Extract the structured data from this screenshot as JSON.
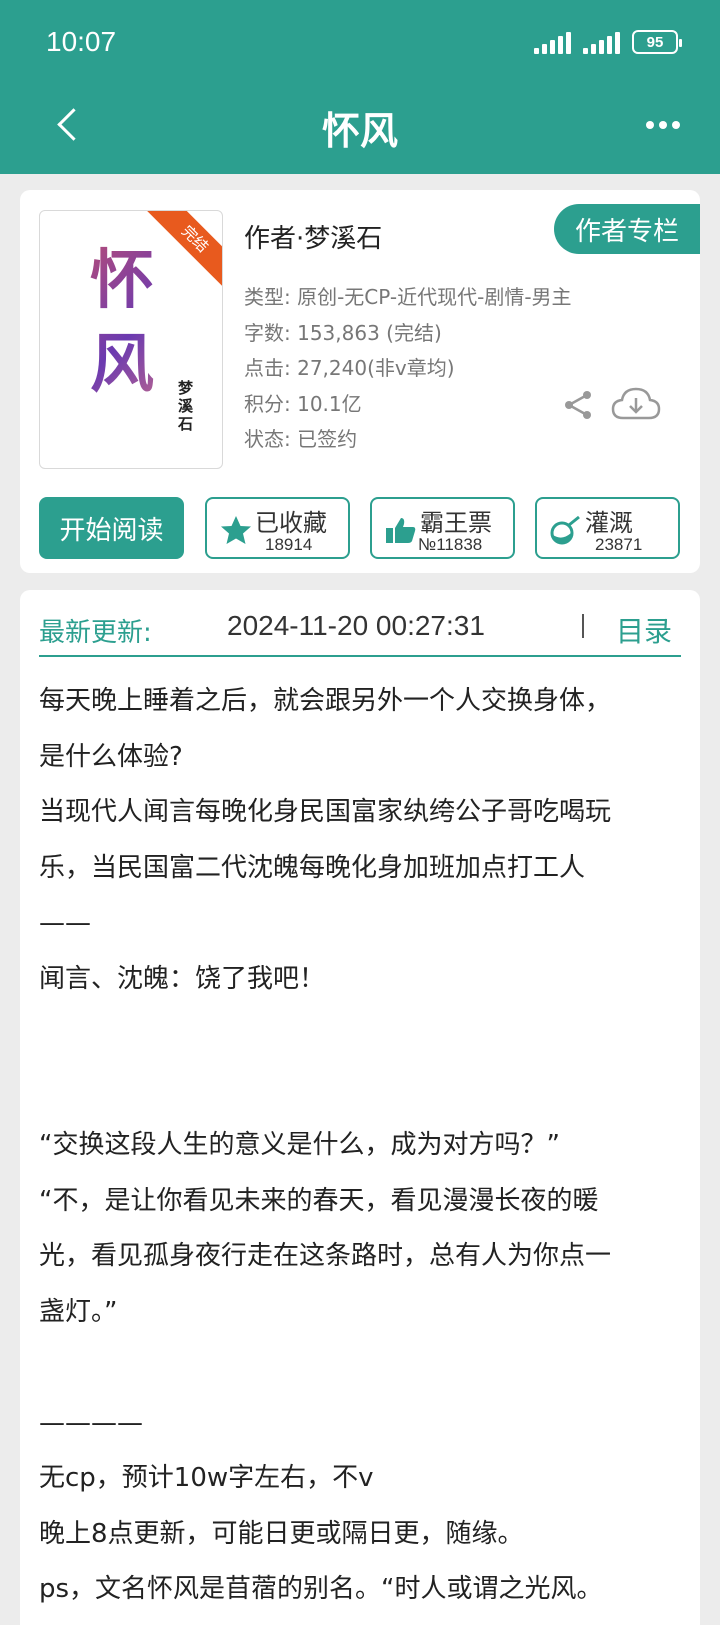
{
  "status_bar": {
    "time": "10:07",
    "battery": "95"
  },
  "nav": {
    "title": "怀风"
  },
  "book": {
    "cover_title": "怀风",
    "cover_author": "梦溪石",
    "cover_badge": "完结",
    "author_line": "作者·梦溪石",
    "author_column_label": "作者专栏",
    "meta": [
      "类型: 原创-无CP-近代现代-剧情-男主",
      "字数: 153,863 (完结)",
      "点击: 27,240(非v章均)",
      "积分: 10.1亿",
      "状态: 已签约"
    ]
  },
  "actions": {
    "read_label": "开始阅读",
    "favorite": {
      "label": "已收藏",
      "count": "18914"
    },
    "bawangpiao": {
      "label": "霸王票",
      "count": "№11838"
    },
    "irrigate": {
      "label": "灌溉",
      "count": "23871"
    }
  },
  "update": {
    "label": "最新更新:",
    "time": "2024-11-20 00:27:31",
    "toc_label": "目录"
  },
  "intro_lines": [
    "每天晚上睡着之后，就会跟另外一个人交换身体，",
    "是什么体验?",
    "当现代人闻言每晚化身民国富家纨绔公子哥吃喝玩",
    "乐，当民国富二代沈魄每晚化身加班加点打工人",
    "——",
    "闻言、沈魄：饶了我吧！",
    "",
    "",
    "“交换这段人生的意义是什么，成为对方吗？”",
    "“不，是让你看见未来的春天，看见漫漫长夜的暖",
    "光，看见孤身夜行走在这条路时，总有人为你点一",
    "盏灯。”",
    "",
    "————",
    "无cp，预计10w字左右，不v",
    "晚上8点更新，可能日更或隔日更，随缘。",
    "ps，文名怀风是苜蓿的别名。“时人或谓之光风。"
  ]
}
